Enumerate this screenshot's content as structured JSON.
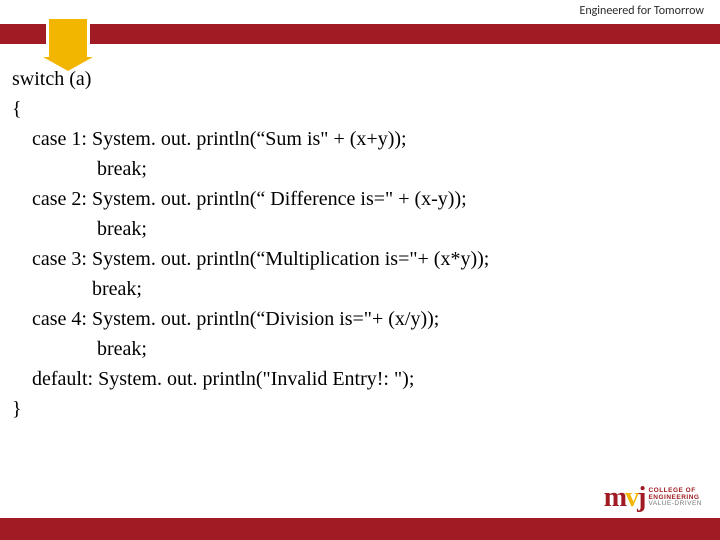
{
  "header": {
    "tagline": "Engineered for Tomorrow"
  },
  "code": {
    "l0": "switch (a)",
    "l1": "{",
    "l2": "    case 1: System. out. println(“Sum is\" + (x+y));",
    "l3": "                 break;",
    "l4": "    case 2: System. out. println(“ Difference is=\" + (x-y));",
    "l5": "                 break;",
    "l6": "    case 3: System. out. println(“Multiplication is=\"+ (x*y));",
    "l7": "                break;",
    "l8": "    case 4: System. out. println(“Division is=\"+ (x/y));",
    "l9": "                 break;",
    "l10": "    default: System. out. println(\"Invalid Entry!: \");",
    "l11": "",
    "l12": "}"
  },
  "logo": {
    "m": "m",
    "v": "v",
    "j": "j",
    "line1": "COLLEGE OF",
    "line2": "ENGINEERING",
    "line3": "value-driven"
  }
}
